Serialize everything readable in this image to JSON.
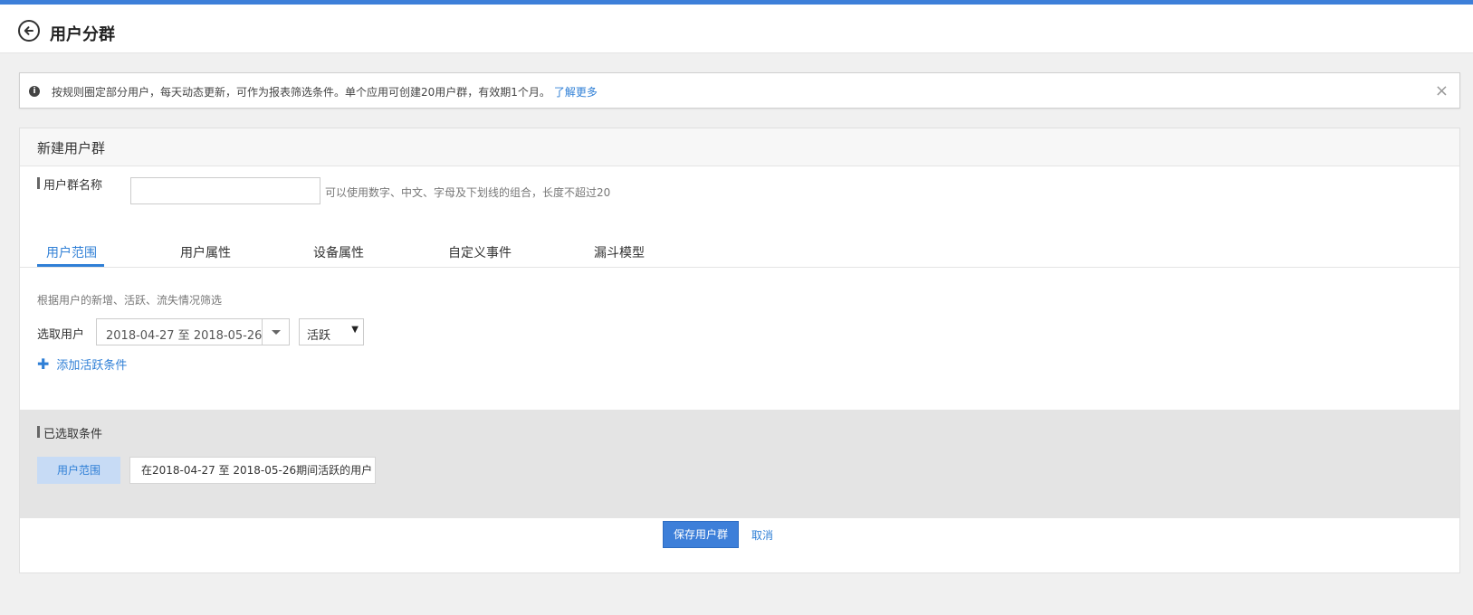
{
  "header": {
    "title": "用户分群"
  },
  "notice": {
    "text": "按规则圈定部分用户，每天动态更新，可作为报表筛选条件。单个应用可创建20用户群，有效期1个月。",
    "link": "了解更多",
    "close": "×"
  },
  "panel": {
    "title": "新建用户群",
    "name_label": "用户群名称",
    "name_value": "",
    "name_hint": "可以使用数字、中文、字母及下划线的组合，长度不超过20"
  },
  "tabs": [
    {
      "label": "用户范围",
      "active": true
    },
    {
      "label": "用户属性",
      "active": false
    },
    {
      "label": "设备属性",
      "active": false
    },
    {
      "label": "自定义事件",
      "active": false
    },
    {
      "label": "漏斗模型",
      "active": false
    }
  ],
  "scope": {
    "description": "根据用户的新增、活跃、流失情况筛选",
    "select_label": "选取用户",
    "date_range": "2018-04-27 至 2018-05-26",
    "status": "活跃",
    "status_caret": "▼",
    "add_condition": "添加活跃条件"
  },
  "selected": {
    "title": "已选取条件",
    "tag": "用户范围",
    "value": "在2018-04-27 至 2018-05-26期间活跃的用户"
  },
  "actions": {
    "save": "保存用户群",
    "cancel": "取消"
  },
  "colors": {
    "accent": "#3d7fd9",
    "link": "#2f7fd6",
    "tag_bg": "#c7dbf5"
  }
}
